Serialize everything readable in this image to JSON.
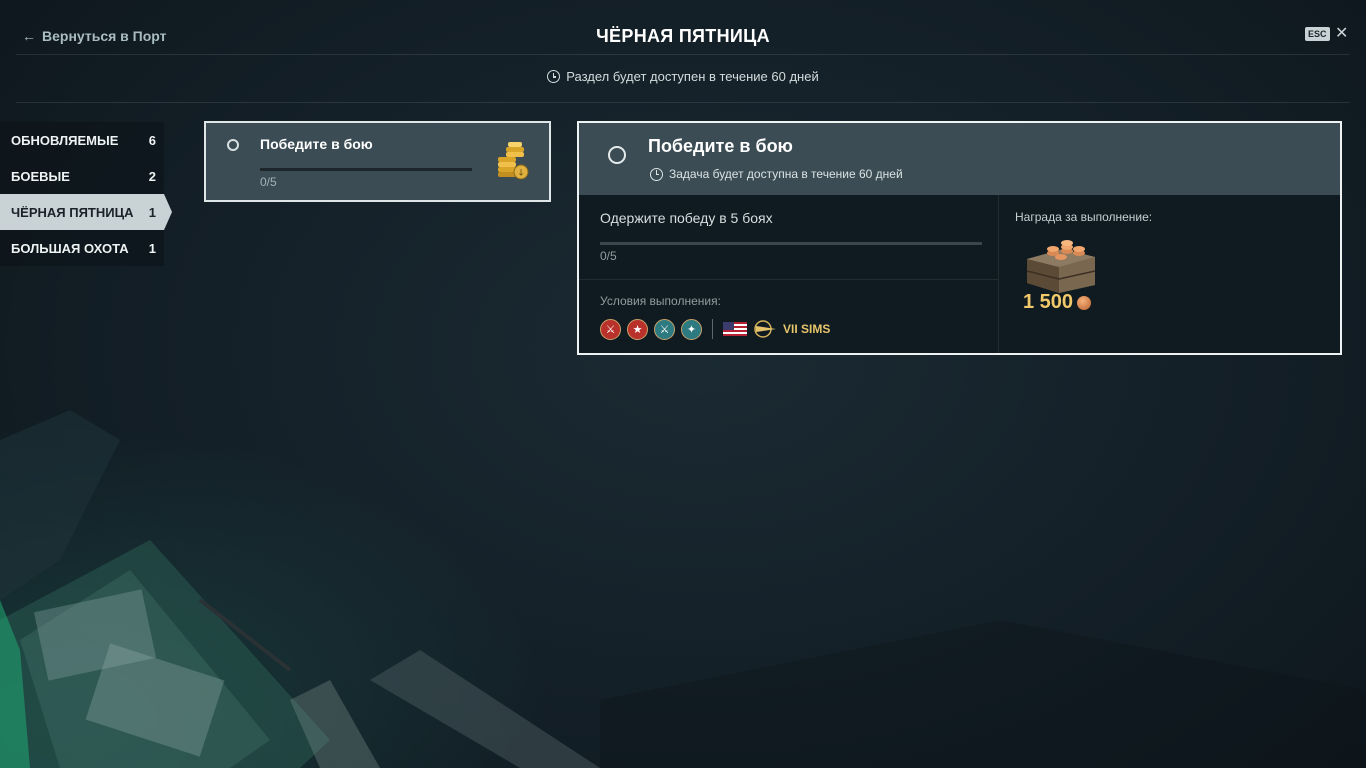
{
  "header": {
    "back_label": "Вернуться в Порт",
    "title": "ЧЁРНАЯ ПЯТНИЦА",
    "esc_label": "ESC",
    "availability": "Раздел будет доступен в течение 60 дней"
  },
  "sidebar": {
    "items": [
      {
        "label": "ОБНОВЛЯЕМЫЕ",
        "count": "6",
        "active": false
      },
      {
        "label": "БОЕВЫЕ",
        "count": "2",
        "active": false
      },
      {
        "label": "ЧЁРНАЯ ПЯТНИЦА",
        "count": "1",
        "active": true
      },
      {
        "label": "БОЛЬШАЯ ОХОТА",
        "count": "1",
        "active": false
      }
    ]
  },
  "task_card": {
    "title": "Победите в бою",
    "progress_text": "0/5",
    "progress": 0,
    "reward_icon": "coins-icon"
  },
  "detail": {
    "title": "Победите в бою",
    "availability": "Задача будет доступна в течение 60 дней",
    "objective": "Одержите победу в 5 боях",
    "progress_text": "0/5",
    "progress": 0,
    "conditions_label": "Условия выполнения:",
    "condition_icons": [
      "battle-type-icon-1",
      "battle-type-icon-2",
      "battle-type-icon-3",
      "battle-type-icon-4"
    ],
    "ship": {
      "nation": "usa-flag-icon",
      "type": "cruiser-class-icon",
      "name": "VII SIMS"
    },
    "reward_label": "Награда за выполнение:",
    "reward_amount": "1 500",
    "reward_icon": "crate-icon"
  },
  "colors": {
    "accent_gold": "#f2c96a",
    "panel_header": "#3b4c54",
    "active_tab": "#c9d3d5"
  }
}
